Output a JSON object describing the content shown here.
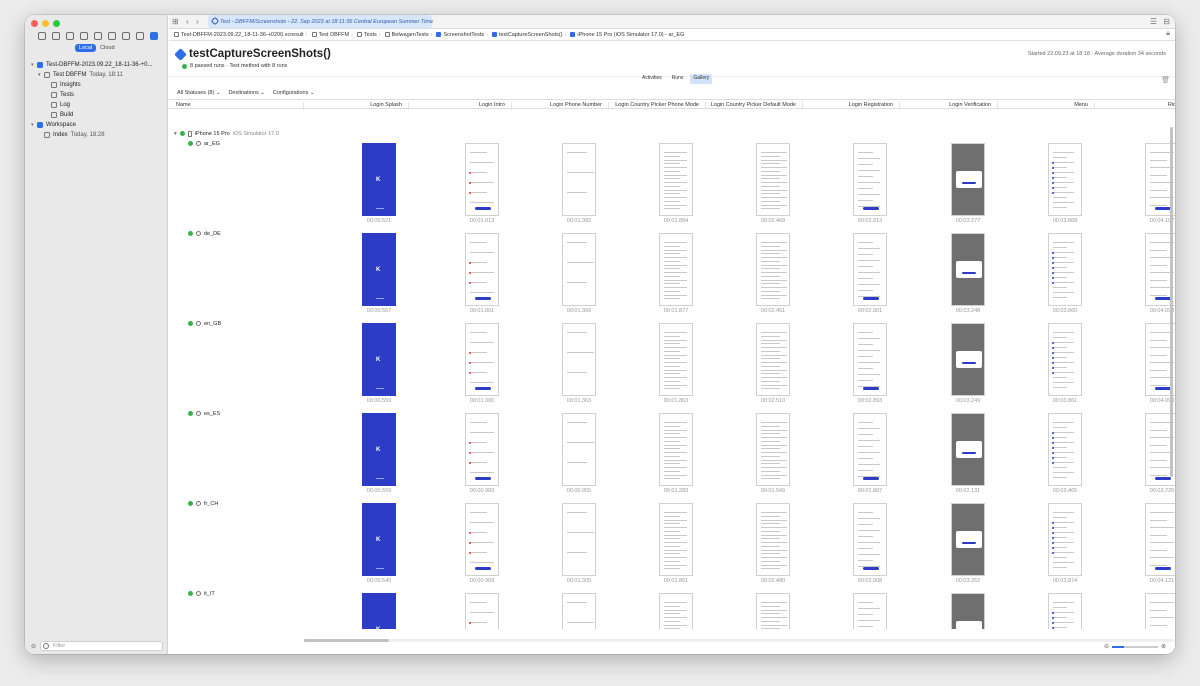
{
  "colors": {
    "accent": "#2f6ee6",
    "splash": "#2c3cc7",
    "pass": "#37b24d"
  },
  "window": {
    "lights": [
      "#fe5f57",
      "#febc2e",
      "#28c840"
    ]
  },
  "sidebar": {
    "segment": {
      "local": "Local",
      "cloud": "Cloud"
    },
    "tree": [
      {
        "label": "Test-DBFFM-2023.09.22_18-11-36-+0...",
        "icon": "xcresult-icon",
        "toggle": "▾",
        "indent": 0
      },
      {
        "label": "Test DBFFM",
        "meta": "Today, 18:11",
        "icon": "test-plan-icon",
        "toggle": "▾",
        "indent": 1
      },
      {
        "label": "Insights",
        "icon": "lightbulb-icon",
        "toggle": "",
        "indent": 2
      },
      {
        "label": "Tests",
        "icon": "diamond-icon",
        "toggle": "",
        "indent": 2
      },
      {
        "label": "Log",
        "icon": "document-icon",
        "toggle": "",
        "indent": 2
      },
      {
        "label": "Build",
        "icon": "hammer-icon",
        "toggle": "",
        "indent": 2
      },
      {
        "label": "Workspace",
        "icon": "workspace-icon",
        "toggle": "▾",
        "indent": 0
      },
      {
        "label": "Index",
        "meta": "Today, 18:28",
        "icon": "hammer-icon",
        "toggle": "",
        "indent": 1
      }
    ],
    "filter_placeholder": "Filter"
  },
  "toolbar": {
    "tab_title": "Test - DBFFM/Screenshots - 22. Sep 2023 at 18:11:36 Central European Summer Time"
  },
  "breadcrumb": [
    "Test-DBFFM-2023.09.22_18-11-36-+0200.xcresult",
    "Test DBFFM",
    "Tests",
    "BelwagenTests",
    "ScreenshotTests",
    "testCaptureScreenShots()",
    "iPhone 15 Pro (iOS Simulator 17.0) - ar_EG"
  ],
  "header": {
    "title": "testCaptureScreenShots()",
    "subtitle": "8 passed runs · Test method with 8 runs",
    "started": "Started 22.09.23 at 18:18 · Average duration 34 seconds"
  },
  "view_tabs": {
    "activities": "Activities",
    "runs": "Runs",
    "gallery": "Gallery"
  },
  "filters": {
    "statuses": "All Statuses (8)",
    "destinations": "Destinations",
    "configurations": "Configurations"
  },
  "columns": {
    "name": "Name",
    "list": [
      "Login Splash",
      "Login Intro",
      "Login Phone Number",
      "Login Country Picker Phone Mode",
      "Login Country Picker Default Mode",
      "Login Registration",
      "Login Verification",
      "Menu",
      "Ride Li"
    ]
  },
  "device": {
    "name": "iPhone 15 Pro",
    "os": "iOS Simulator 17.0"
  },
  "gallery": [
    {
      "locale": "ar_EG",
      "times": [
        "00:00.521",
        "00:01.013",
        "00:01.382",
        "00:01.884",
        "00:02.469",
        "00:02.913",
        "00:03.277",
        "00:03.868",
        "00:04.107"
      ]
    },
    {
      "locale": "de_DE",
      "times": [
        "00:00.557",
        "00:01.001",
        "00:01.366",
        "00:01.877",
        "00:02.451",
        "00:02.901",
        "00:03.248",
        "00:03.860",
        "00:04.098"
      ]
    },
    {
      "locale": "en_GB",
      "times": [
        "00:00.559",
        "00:01.000",
        "00:01.363",
        "00:01.863",
        "00:02.510",
        "00:02.893",
        "00:03.249",
        "00:03.861",
        "00:04.098"
      ]
    },
    {
      "locale": "es_ES",
      "times": [
        "00:00.559",
        "00:00.983",
        "00:00.955",
        "00:01.283",
        "00:01.566",
        "00:01.887",
        "00:02.131",
        "00:03.465",
        "00:03.725"
      ]
    },
    {
      "locale": "fr_CH",
      "times": [
        "00:00.540",
        "00:00.969",
        "00:01.305",
        "00:01.861",
        "00:02.480",
        "00:02.908",
        "00:03.262",
        "00:03.874",
        "00:04.121"
      ]
    },
    {
      "locale": "it_IT",
      "times": [
        "",
        "",
        "",
        "",
        "",
        "",
        "",
        "",
        ""
      ]
    }
  ]
}
